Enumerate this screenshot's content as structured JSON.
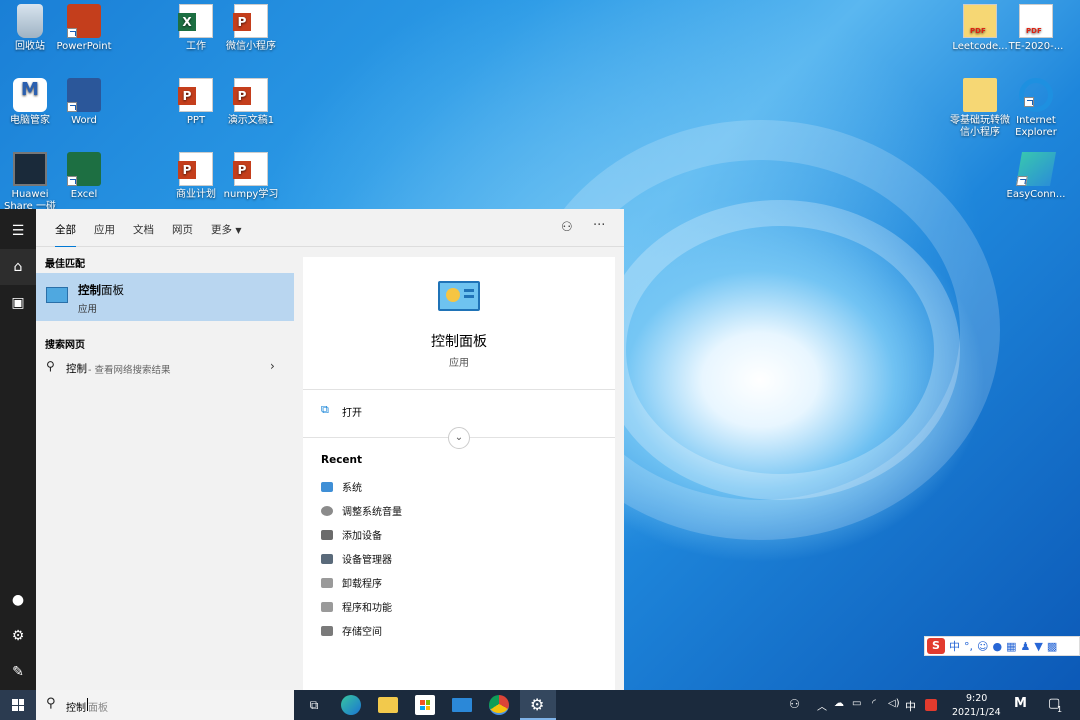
{
  "desktop": {
    "icons": [
      {
        "label": "回收站",
        "icon": "recycle-bin-icon"
      },
      {
        "label": "PowerPoint",
        "icon": "powerpoint-icon"
      },
      {
        "label": "工作",
        "icon": "excel-file-icon"
      },
      {
        "label": "微信小程序",
        "icon": "ppt-file-icon"
      },
      {
        "label": "Leetcode...",
        "icon": "pdf-file-icon"
      },
      {
        "label": "TE-2020-...",
        "icon": "pdf-file-icon"
      },
      {
        "label": "电脑管家",
        "icon": "pc-manager-icon"
      },
      {
        "label": "Word",
        "icon": "word-icon"
      },
      {
        "label": "PPT",
        "icon": "ppt-file-icon"
      },
      {
        "label": "演示文稿1",
        "icon": "ppt-file-icon"
      },
      {
        "label": "零基础玩转微信小程序",
        "icon": "folder-icon"
      },
      {
        "label": "Internet Explorer",
        "icon": "ie-icon"
      },
      {
        "label": "Huawei Share 一碰传",
        "icon": "huawei-share-icon"
      },
      {
        "label": "Excel",
        "icon": "excel-icon"
      },
      {
        "label": "商业计划",
        "icon": "ppt-file-icon"
      },
      {
        "label": "numpy学习",
        "icon": "ppt-file-icon"
      },
      {
        "label": "EasyConn...",
        "icon": "easyconnect-icon"
      }
    ]
  },
  "start_menu": {
    "tabs": [
      "全部",
      "应用",
      "文档",
      "网页",
      "更多"
    ],
    "active_tab": "全部",
    "best_match_title": "最佳匹配",
    "best_match": {
      "name_bold": "控制",
      "name_rest": "面板",
      "type": "应用"
    },
    "web_title": "搜索网页",
    "web_query": "控制",
    "web_hint": " - 查看网络搜索结果",
    "detail": {
      "name": "控制面板",
      "type": "应用",
      "open_label": "打开",
      "recent_title": "Recent",
      "recent": [
        "系统",
        "调整系统音量",
        "添加设备",
        "设备管理器",
        "卸载程序",
        "程序和功能",
        "存储空间"
      ]
    }
  },
  "taskbar": {
    "search_typed": "控制",
    "search_suggest": "面板",
    "ime_mode": "中",
    "time": "9:20",
    "date": "2021/1/24",
    "notification_count": "1"
  },
  "ime_bar": {
    "mode": "中",
    "punct": "°,"
  },
  "colors": {
    "accent": "#0078d4",
    "selection": "#b9d6f0",
    "taskbar": "#1b2a3d"
  }
}
